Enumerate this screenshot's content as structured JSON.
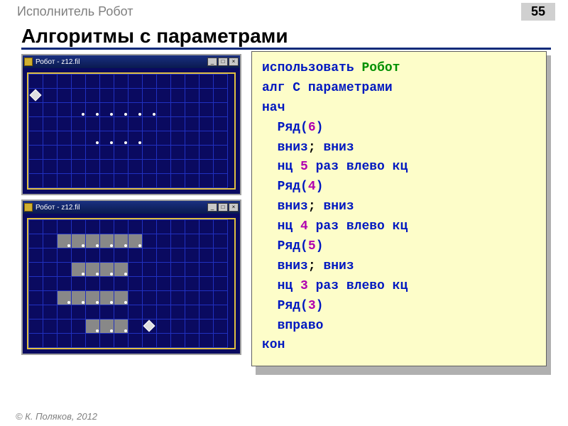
{
  "page": {
    "header": "Исполнитель Робот",
    "number": "55",
    "title": "Алгоритмы с параметрами",
    "footer": "К. Поляков, 2012",
    "copyright": "©"
  },
  "window1": {
    "title": "Робот - z12.fil",
    "btn_min": "_",
    "btn_max": "□",
    "btn_close": "×",
    "rows": 8,
    "cols": 14,
    "robot": {
      "r": 2,
      "c": 1
    },
    "dots": [
      {
        "r": 3,
        "c": 4
      },
      {
        "r": 3,
        "c": 5
      },
      {
        "r": 3,
        "c": 6
      },
      {
        "r": 3,
        "c": 7
      },
      {
        "r": 3,
        "c": 8
      },
      {
        "r": 3,
        "c": 9
      },
      {
        "r": 5,
        "c": 5
      },
      {
        "r": 5,
        "c": 6
      },
      {
        "r": 5,
        "c": 7
      },
      {
        "r": 5,
        "c": 8
      }
    ]
  },
  "window2": {
    "title": "Робот - z12.fil",
    "btn_min": "_",
    "btn_max": "□",
    "btn_close": "×",
    "rows": 9,
    "cols": 14,
    "robot": {
      "r": 8,
      "c": 9
    },
    "gray": [
      {
        "r": 2,
        "c": 3
      },
      {
        "r": 2,
        "c": 4
      },
      {
        "r": 2,
        "c": 5
      },
      {
        "r": 2,
        "c": 6
      },
      {
        "r": 2,
        "c": 7
      },
      {
        "r": 2,
        "c": 8
      },
      {
        "r": 4,
        "c": 4
      },
      {
        "r": 4,
        "c": 5
      },
      {
        "r": 4,
        "c": 6
      },
      {
        "r": 4,
        "c": 7
      },
      {
        "r": 6,
        "c": 3
      },
      {
        "r": 6,
        "c": 4
      },
      {
        "r": 6,
        "c": 5
      },
      {
        "r": 6,
        "c": 6
      },
      {
        "r": 6,
        "c": 7
      },
      {
        "r": 8,
        "c": 5
      },
      {
        "r": 8,
        "c": 6
      },
      {
        "r": 8,
        "c": 7
      }
    ],
    "dots": [
      {
        "r": 2,
        "c": 3
      },
      {
        "r": 2,
        "c": 4
      },
      {
        "r": 2,
        "c": 5
      },
      {
        "r": 2,
        "c": 6
      },
      {
        "r": 2,
        "c": 7
      },
      {
        "r": 2,
        "c": 8
      },
      {
        "r": 4,
        "c": 4
      },
      {
        "r": 4,
        "c": 5
      },
      {
        "r": 4,
        "c": 6
      },
      {
        "r": 4,
        "c": 7
      },
      {
        "r": 6,
        "c": 3
      },
      {
        "r": 6,
        "c": 4
      },
      {
        "r": 6,
        "c": 5
      },
      {
        "r": 6,
        "c": 6
      },
      {
        "r": 6,
        "c": 7
      },
      {
        "r": 8,
        "c": 5
      },
      {
        "r": 8,
        "c": 6
      },
      {
        "r": 8,
        "c": 7
      }
    ]
  },
  "code": {
    "t_use": "использовать ",
    "t_robot": "Робот",
    "t_alg": "алг ",
    "t_algname": "С параметрами",
    "t_begin": "нач",
    "t_row": "Ряд",
    "t_lp": "(",
    "t_rp": ")",
    "n6": "6",
    "n5": "5",
    "n4": "4",
    "n3": "3",
    "t_down": "вниз",
    "t_semi": "; ",
    "t_loop": "нц ",
    "t_times": " раз ",
    "t_left": "влево",
    "t_kc": " кц",
    "t_right": "вправо",
    "t_end": "кон",
    "indent": "  "
  }
}
